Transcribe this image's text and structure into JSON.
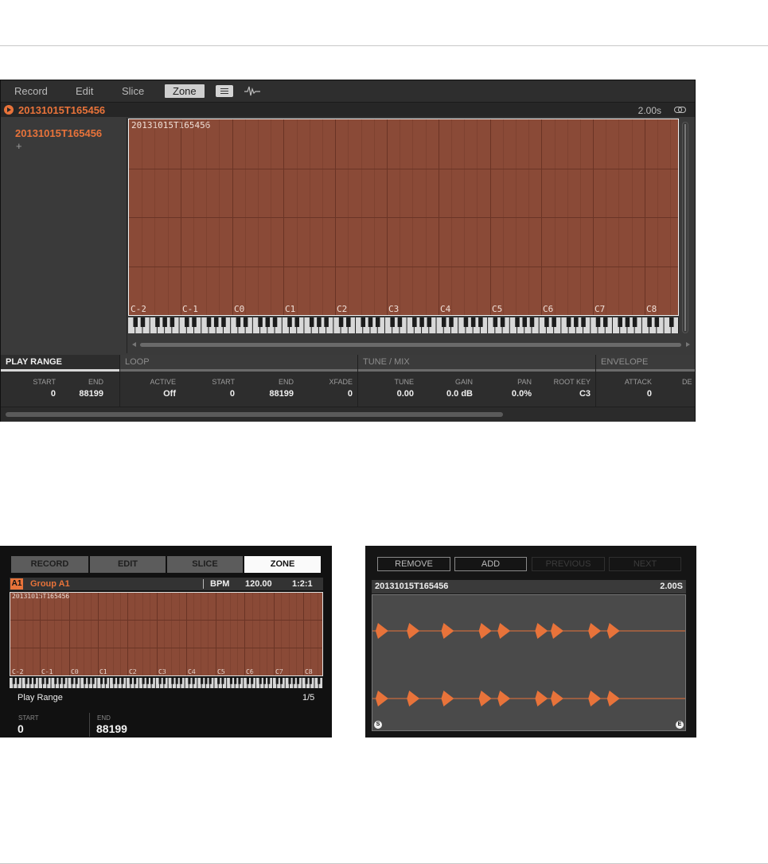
{
  "software": {
    "tabs": [
      "Record",
      "Edit",
      "Slice",
      "Zone"
    ],
    "icons": [
      "list-icon",
      "waveform-icon"
    ],
    "header": {
      "sample_name": "20131015T165456",
      "length": "2.00s"
    },
    "zone_list": {
      "items": [
        "20131015T165456"
      ],
      "add_label": "+"
    },
    "zone_map": {
      "zone_label": "20131015T165456",
      "octaves": [
        "C-2",
        "C-1",
        "C0",
        "C1",
        "C2",
        "C3",
        "C4",
        "C5",
        "C6",
        "C7",
        "C8"
      ],
      "zone_color": "#8a4a37"
    },
    "sections": [
      {
        "title": "PLAY RANGE",
        "params": [
          {
            "label": "START",
            "value": "0"
          },
          {
            "label": "END",
            "value": "88199"
          }
        ]
      },
      {
        "title": "LOOP",
        "params": [
          {
            "label": "ACTIVE",
            "value": "Off"
          },
          {
            "label": "START",
            "value": "0"
          },
          {
            "label": "END",
            "value": "88199"
          },
          {
            "label": "XFADE",
            "value": "0"
          }
        ]
      },
      {
        "title": "TUNE / MIX",
        "params": [
          {
            "label": "TUNE",
            "value": "0.00"
          },
          {
            "label": "GAIN",
            "value": "0.0 dB"
          },
          {
            "label": "PAN",
            "value": "0.0%"
          },
          {
            "label": "ROOT KEY",
            "value": "C3"
          }
        ]
      },
      {
        "title": "ENVELOPE",
        "params": [
          {
            "label": "ATTACK",
            "value": "0"
          },
          {
            "label": "DE",
            "value": ""
          }
        ]
      }
    ],
    "accent_color": "#e8733a"
  },
  "hardware_left": {
    "tabs": [
      "RECORD",
      "EDIT",
      "SLICE",
      "ZONE"
    ],
    "group_badge": "A1",
    "group_name": "Group A1",
    "bpm_label": "BPM",
    "bpm_value": "120.00",
    "position": "1:2:1",
    "zone_label": "20131015T165456",
    "octaves": [
      "C-2",
      "C-1",
      "C0",
      "C1",
      "C2",
      "C3",
      "C4",
      "C5",
      "C6",
      "C7",
      "C8"
    ],
    "page_title": "Play Range",
    "page_index": "1/5",
    "start_label": "START",
    "start_value": "0",
    "end_label": "END",
    "end_value": "88199"
  },
  "hardware_right": {
    "buttons": [
      "REMOVE",
      "ADD",
      "PREVIOUS",
      "NEXT"
    ],
    "sample_name": "20131015T165456",
    "length": "2.00S",
    "start_marker": "S",
    "end_marker": "E",
    "waveform_color": "#e8733a"
  }
}
